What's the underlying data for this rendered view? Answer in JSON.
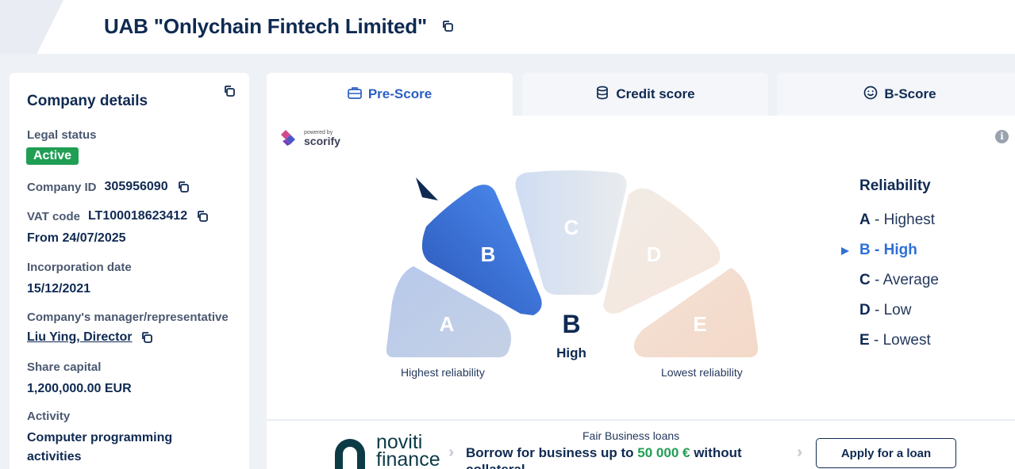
{
  "header": {
    "title": "UAB \"Onlychain Fintech Limited\"",
    "copy_icon": "copy-icon"
  },
  "company": {
    "heading": "Company details",
    "legal_status_label": "Legal status",
    "legal_status_value": "Active",
    "company_id_label": "Company ID",
    "company_id_value": "305956090",
    "vat_label": "VAT code",
    "vat_value": "LT100018623412",
    "vat_from": "From 24/07/2025",
    "incorporation_label": "Incorporation date",
    "incorporation_value": "15/12/2021",
    "manager_label": "Company's manager/representative",
    "manager_value": "Liu Ying, Director",
    "capital_label": "Share capital",
    "capital_value": "1,200,000.00 EUR",
    "activity_label": "Activity",
    "activity_value_line1": "Computer programming",
    "activity_value_line2": "activities"
  },
  "tabs": [
    {
      "label": "Pre-Score",
      "icon": "briefcase-icon",
      "active": true
    },
    {
      "label": "Credit score",
      "icon": "coins-icon",
      "active": false
    },
    {
      "label": "B-Score",
      "icon": "smiley-icon",
      "active": false
    }
  ],
  "powered": {
    "small": "powered by",
    "brand": "scorify"
  },
  "gauge": {
    "segments": [
      "A",
      "B",
      "C",
      "D",
      "E"
    ],
    "selected": "B",
    "score_letter": "B",
    "score_word": "High",
    "left_caption": "Highest reliability",
    "right_caption": "Lowest reliability"
  },
  "reliability": {
    "title": "Reliability",
    "items": [
      {
        "letter": "A",
        "text": " - Highest"
      },
      {
        "letter": "B",
        "text": " - High"
      },
      {
        "letter": "C",
        "text": " - Average"
      },
      {
        "letter": "D",
        "text": " - Low"
      },
      {
        "letter": "E",
        "text": " - Lowest"
      }
    ],
    "selected_index": 1
  },
  "banner": {
    "brand_line1": "noviti",
    "brand_line2": "finance",
    "title": "Fair Business loans",
    "text_before": "Borrow for business up to ",
    "amount": "50 000 €",
    "text_after": " without collateral",
    "button": "Apply for a loan"
  },
  "colors": {
    "navy": "#0f2a52",
    "accent_blue": "#2f6fd6",
    "active_green": "#1f9e54"
  }
}
